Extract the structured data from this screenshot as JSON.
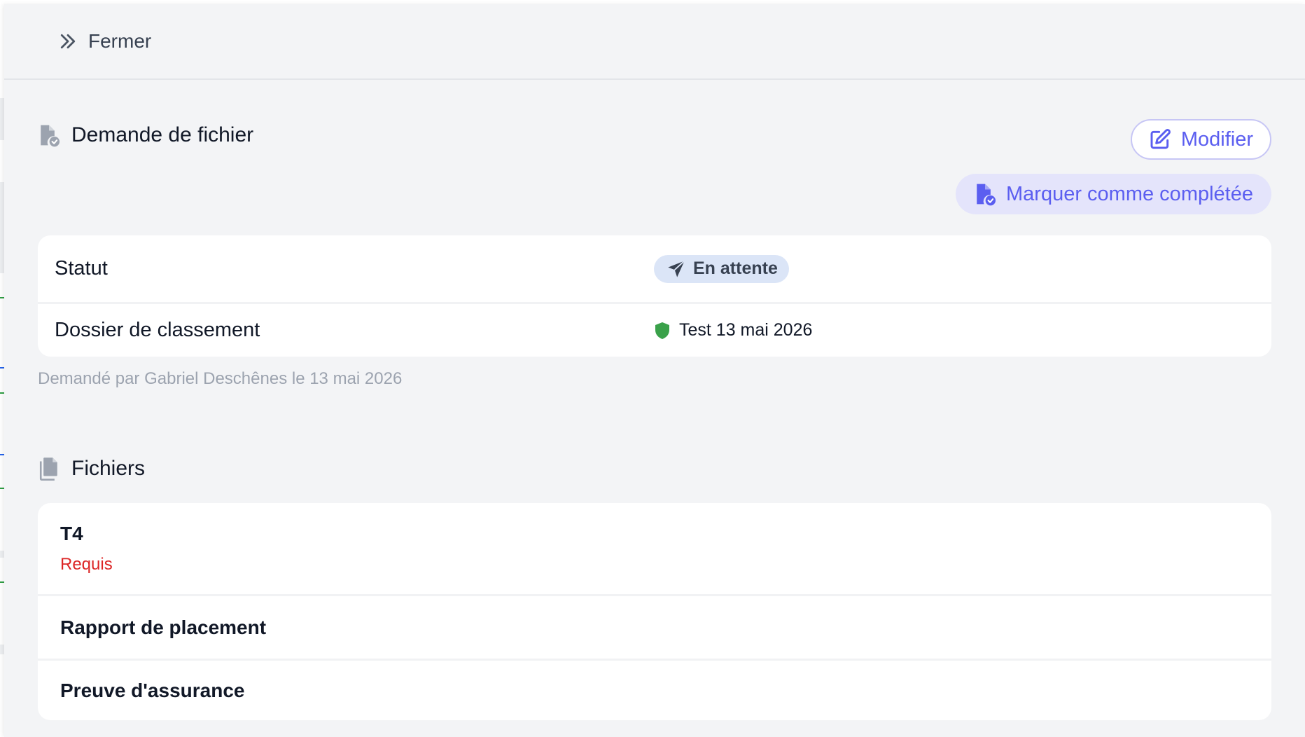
{
  "header": {
    "close_label": "Fermer",
    "close_icon": "double-chevron-right-icon"
  },
  "request_section": {
    "title": "Demande de fichier",
    "title_icon": "file-check-icon",
    "edit_label": "Modifier",
    "edit_icon": "edit-icon",
    "complete_label": "Marquer comme complétée",
    "complete_icon": "file-check-icon",
    "rows": [
      {
        "label": "Statut",
        "value": "En attente",
        "value_icon": "paper-plane-icon"
      },
      {
        "label": "Dossier de classement",
        "value": "Test 13 mai 2026",
        "value_icon": "shield-icon"
      }
    ],
    "meta": "Demandé par Gabriel Deschênes le 13 mai 2026"
  },
  "files_section": {
    "title": "Fichiers",
    "title_icon": "files-icon",
    "items": [
      {
        "name": "T4",
        "requirement": "Requis"
      },
      {
        "name": "Rapport de placement"
      },
      {
        "name": "Preuve d'assurance"
      }
    ]
  },
  "colors": {
    "accent": "#5b5ef0",
    "status_badge_bg": "#dbe5f7",
    "shield_green": "#3aa14a",
    "required_red": "#dc2626",
    "meta_gray": "#9ca3af"
  }
}
